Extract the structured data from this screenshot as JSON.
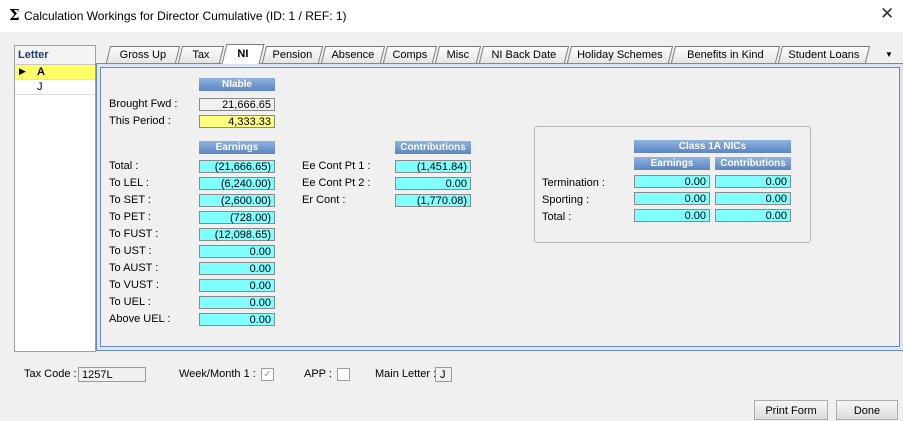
{
  "window": {
    "icon": "Σ",
    "title": "Calculation Workings for Director Cumulative (ID: 1 / REF: 1)",
    "close_glyph": "✕"
  },
  "letter_list": {
    "header": "Letter",
    "selected_arrow": "▶",
    "items": [
      "A",
      "J"
    ]
  },
  "tabs": [
    "Gross Up",
    "Tax",
    "NI",
    "Pension",
    "Absence",
    "Comps",
    "Misc",
    "NI Back Date",
    "Holiday Schemes",
    "Benefits in Kind",
    "Student Loans"
  ],
  "active_tab": "NI",
  "tab_overflow_icon": "▼",
  "niable": {
    "header": "NIable",
    "brought_fwd_label": "Brought Fwd :",
    "brought_fwd_value": "21,666.65",
    "this_period_label": "This Period :",
    "this_period_value": "4,333.33"
  },
  "earnings": {
    "header": "Earnings",
    "rows": [
      {
        "label": "Total :",
        "value": "(21,666.65)"
      },
      {
        "label": "To LEL :",
        "value": "(6,240.00)"
      },
      {
        "label": "To SET :",
        "value": "(2,600.00)"
      },
      {
        "label": "To PET :",
        "value": "(728.00)"
      },
      {
        "label": "To FUST :",
        "value": "(12,098.65)"
      },
      {
        "label": "To UST :",
        "value": "0.00"
      },
      {
        "label": "To AUST :",
        "value": "0.00"
      },
      {
        "label": "To VUST :",
        "value": "0.00"
      },
      {
        "label": "To UEL :",
        "value": "0.00"
      },
      {
        "label": "Above UEL :",
        "value": "0.00"
      }
    ]
  },
  "contributions": {
    "header": "Contributions",
    "rows": [
      {
        "label": "Ee Cont Pt 1 :",
        "value": "(1,451.84)"
      },
      {
        "label": "Ee Cont Pt 2 :",
        "value": "0.00"
      },
      {
        "label": "Er Cont :",
        "value": "(1,770.08)"
      }
    ]
  },
  "class1a": {
    "header": "Class 1A NICs",
    "earnings_header": "Earnings",
    "contributions_header": "Contributions",
    "rows": [
      {
        "label": "Termination :",
        "earnings": "0.00",
        "contributions": "0.00"
      },
      {
        "label": "Sporting :",
        "earnings": "0.00",
        "contributions": "0.00"
      },
      {
        "label": "Total :",
        "earnings": "0.00",
        "contributions": "0.00"
      }
    ]
  },
  "footer": {
    "tax_code_label": "Tax Code :",
    "tax_code_value": "1257L",
    "week_month_label": "Week/Month 1 :",
    "week_month_check": "✓",
    "app_label": "APP :",
    "main_letter_label": "Main Letter :",
    "main_letter_value": "J",
    "print_button": "Print Form",
    "done_button": "Done"
  }
}
